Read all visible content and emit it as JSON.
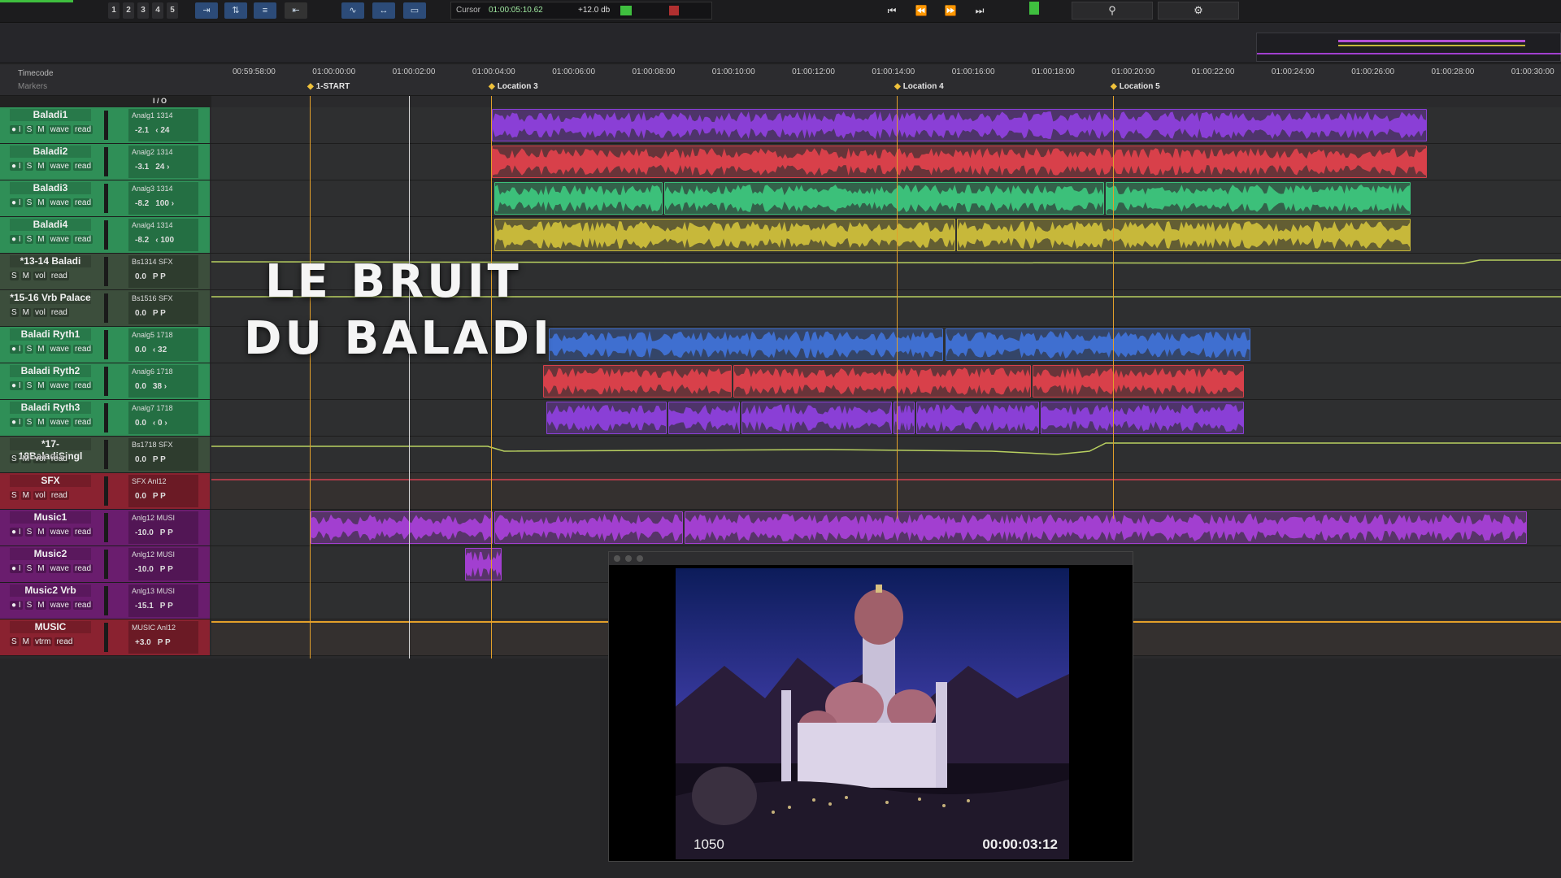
{
  "toolbar": {
    "numbers": [
      "1",
      "2",
      "3",
      "4",
      "5"
    ],
    "cursor_label": "Cursor",
    "cursor_value": "01:00:05:10.62",
    "gain_value": "+12.0 db",
    "search_icon": "search-icon",
    "settings_icon": "gear-icon"
  },
  "rulers": {
    "timecode_label": "Timecode",
    "markers_label": "Markers",
    "timecodes": [
      "00:59:58:00",
      "01:00:00:00",
      "01:00:02:00",
      "01:00:04:00",
      "01:00:06:00",
      "01:00:08:00",
      "01:00:10:00",
      "01:00:12:00",
      "01:00:14:00",
      "01:00:16:00",
      "01:00:18:00",
      "01:00:20:00",
      "01:00:22:00",
      "01:00:24:00",
      "01:00:26:00",
      "01:00:28:00",
      "01:00:30:00"
    ],
    "markers": [
      "1-START",
      "Location 3",
      "Location 4",
      "Location 5"
    ]
  },
  "header_row": {
    "io_label": "I / O"
  },
  "tracks": [
    {
      "name": "Baladi1",
      "ctrls": [
        "● I",
        "S",
        "M",
        "wave",
        "read"
      ],
      "io_top": "Analg1  1314",
      "vol": "-2.1",
      "pan": "‹ 24",
      "color": "#2f8f57"
    },
    {
      "name": "Baladi2",
      "ctrls": [
        "● I",
        "S",
        "M",
        "wave",
        "read"
      ],
      "io_top": "Analg2  1314",
      "vol": "-3.1",
      "pan": "24 ›",
      "color": "#2f8f57"
    },
    {
      "name": "Baladi3",
      "ctrls": [
        "● I",
        "S",
        "M",
        "wave",
        "read"
      ],
      "io_top": "Analg3  1314",
      "vol": "-8.2",
      "pan": "100 ›",
      "color": "#2f8f57"
    },
    {
      "name": "Baladi4",
      "ctrls": [
        "● I",
        "S",
        "M",
        "wave",
        "read"
      ],
      "io_top": "Analg4  1314",
      "vol": "-8.2",
      "pan": "‹ 100",
      "color": "#2f8f57"
    },
    {
      "name": "*13-14 Baladi",
      "ctrls": [
        "S",
        "M",
        "vol",
        "read"
      ],
      "io_top": "Bs1314  SFX",
      "vol": "0.0",
      "pan": "P  P",
      "color": "#3c4e3c"
    },
    {
      "name": "*15-16 Vrb Palace",
      "ctrls": [
        "S",
        "M",
        "vol",
        "read"
      ],
      "io_top": "Bs1516  SFX",
      "vol": "0.0",
      "pan": "P  P",
      "color": "#3c4e3c"
    },
    {
      "name": "Baladi Ryth1",
      "ctrls": [
        "● I",
        "S",
        "M",
        "wave",
        "read"
      ],
      "io_top": "Analg5  1718",
      "vol": "0.0",
      "pan": "‹ 32",
      "color": "#2f8f57"
    },
    {
      "name": "Baladi Ryth2",
      "ctrls": [
        "● I",
        "S",
        "M",
        "wave",
        "read"
      ],
      "io_top": "Analg6  1718",
      "vol": "0.0",
      "pan": "38 ›",
      "color": "#2f8f57"
    },
    {
      "name": "Baladi Ryth3",
      "ctrls": [
        "● I",
        "S",
        "M",
        "wave",
        "read"
      ],
      "io_top": "Analg7  1718",
      "vol": "0.0",
      "pan": "‹ 0 ›",
      "color": "#2f8f57"
    },
    {
      "name": "*17-18BaladiSingl",
      "ctrls": [
        "S",
        "M",
        "vol",
        "read"
      ],
      "io_top": "Bs1718  SFX",
      "vol": "0.0",
      "pan": "P  P",
      "color": "#3c4e3c"
    },
    {
      "name": "SFX",
      "ctrls": [
        "S",
        "M",
        "vol",
        "read"
      ],
      "io_top": "SFX  Anl12",
      "vol": "0.0",
      "pan": "P  P",
      "color": "#8a2230"
    },
    {
      "name": "Music1",
      "ctrls": [
        "● I",
        "S",
        "M",
        "wave",
        "read"
      ],
      "io_top": "Anlg12  MUSI",
      "vol": "-10.0",
      "pan": "P  P",
      "color": "#6a1d6e"
    },
    {
      "name": "Music2",
      "ctrls": [
        "● I",
        "S",
        "M",
        "wave",
        "read"
      ],
      "io_top": "Anlg12  MUSI",
      "vol": "-10.0",
      "pan": "P  P",
      "color": "#6a1d6e"
    },
    {
      "name": "Music2 Vrb",
      "ctrls": [
        "● I",
        "S",
        "M",
        "wave",
        "read"
      ],
      "io_top": "Anlg13  MUSI",
      "vol": "-15.1",
      "pan": "P  P",
      "color": "#6a1d6e"
    },
    {
      "name": "MUSIC",
      "ctrls": [
        "S",
        "M",
        "vtrm",
        "read"
      ],
      "io_top": "MUSIC  Anl12",
      "vol": "+3.0",
      "pan": "P  P",
      "color": "#8a2230"
    }
  ],
  "overlay": {
    "line1": "LE BRUIT",
    "line2": "DU BALADI"
  },
  "video": {
    "frame_label": "1050",
    "timecode": "00:00:03:12"
  },
  "colors": {
    "purple": "#8a3fd6",
    "red": "#d8404a",
    "green": "#3cc07a",
    "yellow": "#c7b83a",
    "blue": "#3f6fd0",
    "music": "#a23fd0",
    "orange_line": "#e3a02a"
  }
}
